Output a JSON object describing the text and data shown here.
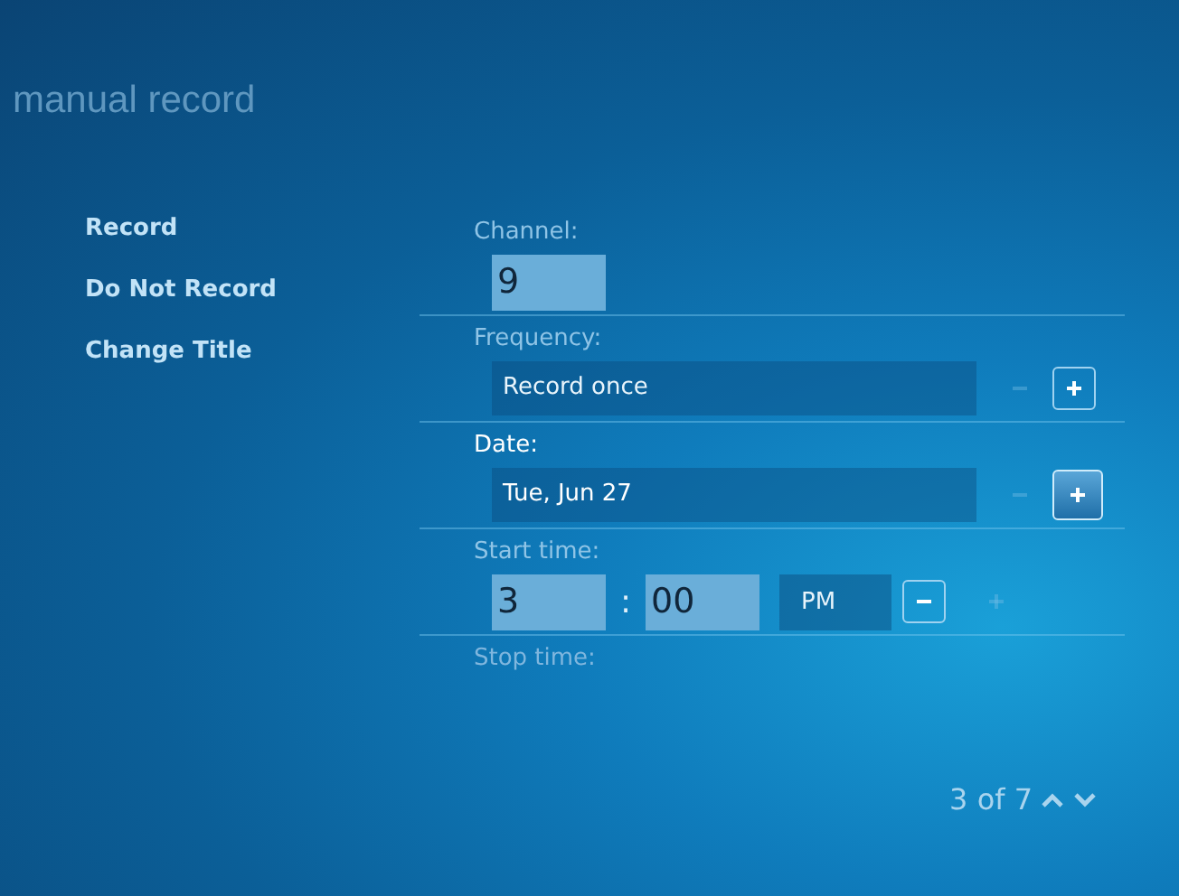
{
  "title": "manual record",
  "actions": [
    {
      "label": "Record"
    },
    {
      "label": "Do Not Record"
    },
    {
      "label": "Change Title"
    }
  ],
  "fields": [
    {
      "kind": "number",
      "label": "Channel:",
      "value": "9",
      "focused": false
    },
    {
      "kind": "spinner",
      "label": "Frequency:",
      "value": "Record once",
      "focused": false,
      "minus_disabled": true,
      "plus_disabled": false
    },
    {
      "kind": "spinner",
      "label": "Date:",
      "value": "Tue, Jun 27",
      "focused": true,
      "minus_disabled": true,
      "plus_disabled": false
    },
    {
      "kind": "time",
      "label": "Start time:",
      "hour": "3",
      "separator": ":",
      "minute": "00",
      "period": "PM",
      "focused": false,
      "minus_disabled": false,
      "plus_disabled": true
    },
    {
      "kind": "label",
      "label": "Stop time:",
      "disabled": true
    }
  ],
  "pager": {
    "text": "3 of 7"
  }
}
